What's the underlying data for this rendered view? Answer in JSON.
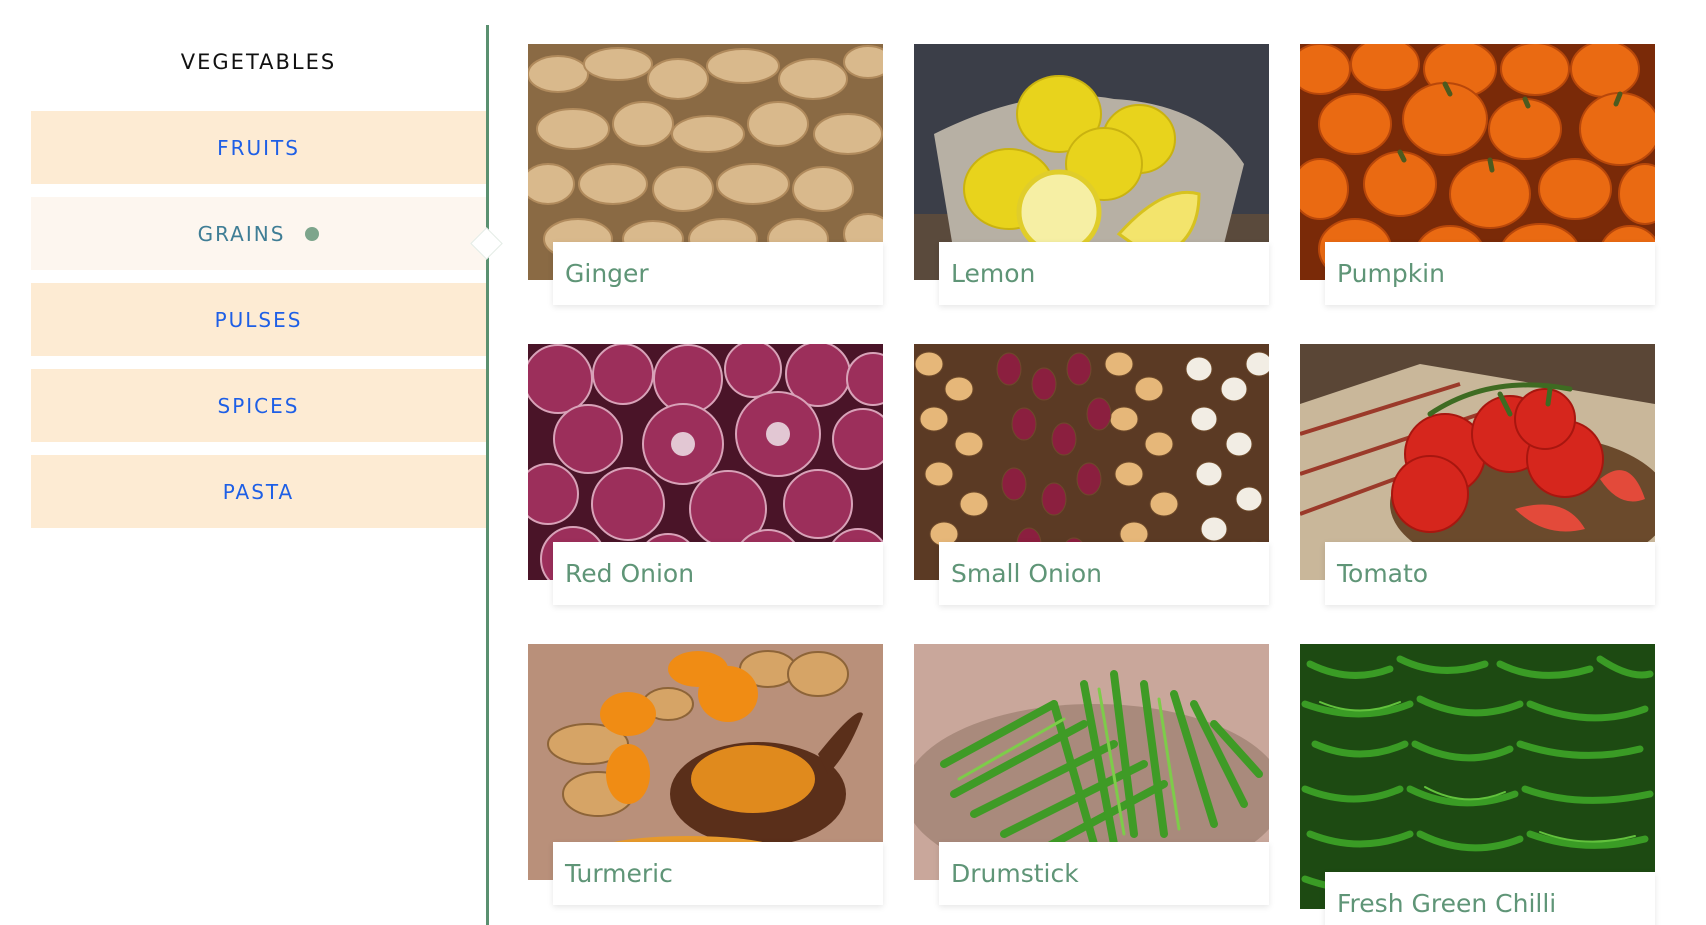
{
  "sidebar": {
    "title": "VEGETABLES",
    "items": [
      {
        "label": "FRUITS"
      },
      {
        "label": "GRAINS",
        "active": true
      },
      {
        "label": "PULSES"
      },
      {
        "label": "SPICES"
      },
      {
        "label": "PASTA"
      }
    ]
  },
  "products": [
    {
      "name": "Ginger",
      "image": "ginger-photo"
    },
    {
      "name": "Lemon",
      "image": "lemon-photo"
    },
    {
      "name": "Pumpkin",
      "image": "pumpkin-photo"
    },
    {
      "name": "Red Onion",
      "image": "red-onion-photo"
    },
    {
      "name": "Small Onion",
      "image": "small-onion-photo"
    },
    {
      "name": "Tomato",
      "image": "tomato-photo"
    },
    {
      "name": "Turmeric",
      "image": "turmeric-photo"
    },
    {
      "name": "Drumstick",
      "image": "drumstick-photo"
    },
    {
      "name": "Fresh Green Chilli",
      "image": "green-chilli-photo"
    }
  ],
  "colors": {
    "sidebar_item_bg": "#fdebd3",
    "sidebar_item_active_bg": "#fdf6ef",
    "sidebar_item_text": "#1e5fe6",
    "sidebar_item_active_text": "#3f7d95",
    "product_label_text": "#5f9577",
    "divider": "#5a9070"
  }
}
